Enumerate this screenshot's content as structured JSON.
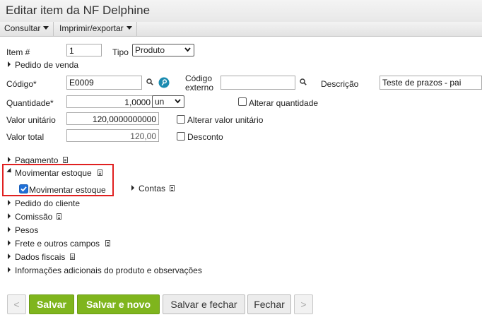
{
  "window": {
    "title": "Editar item da NF Delphine"
  },
  "toolbar": {
    "consultar": "Consultar",
    "imprimir": "Imprimir/exportar"
  },
  "form": {
    "item_label": "Item #",
    "item_value": "1",
    "tipo_label": "Tipo",
    "tipo_value": "Produto",
    "pedido_venda": "Pedido de venda",
    "codigo_label": "Código*",
    "codigo_value": "E0009",
    "codigo_externo_label_1": "Código",
    "codigo_externo_label_2": "externo",
    "codigo_externo_value": "",
    "descricao_label": "Descrição",
    "descricao_value": "Teste de prazos - pai",
    "quantidade_label": "Quantidade*",
    "quantidade_value": "1,0000",
    "unidade_value": "un",
    "alterar_quantidade": "Alterar quantidade",
    "valor_unitario_label": "Valor unitário",
    "valor_unitario_value": "120,0000000000",
    "alterar_valor_unitario": "Alterar valor unitário",
    "valor_total_label": "Valor total",
    "valor_total_value": "120,00",
    "desconto": "Desconto"
  },
  "sections": {
    "pagamento": "Pagamento",
    "movimentar_estoque": "Movimentar estoque",
    "movimentar_estoque_check": "Movimentar estoque",
    "movimentar_estoque_checked": true,
    "contas": "Contas",
    "pedido_cliente": "Pedido do cliente",
    "comissao": "Comissão",
    "pesos": "Pesos",
    "frete": "Frete e outros campos",
    "dados_fiscais": "Dados fiscais",
    "info_adicionais": "Informações adicionais do produto e observações"
  },
  "footer": {
    "prev": "<",
    "salvar": "Salvar",
    "salvar_novo": "Salvar e novo",
    "salvar_fechar": "Salvar e fechar",
    "fechar": "Fechar",
    "next": ">"
  },
  "colors": {
    "primary_button": "#7fb51d",
    "highlight_box": "#e02020",
    "info_icon": "#1b8bb0"
  }
}
